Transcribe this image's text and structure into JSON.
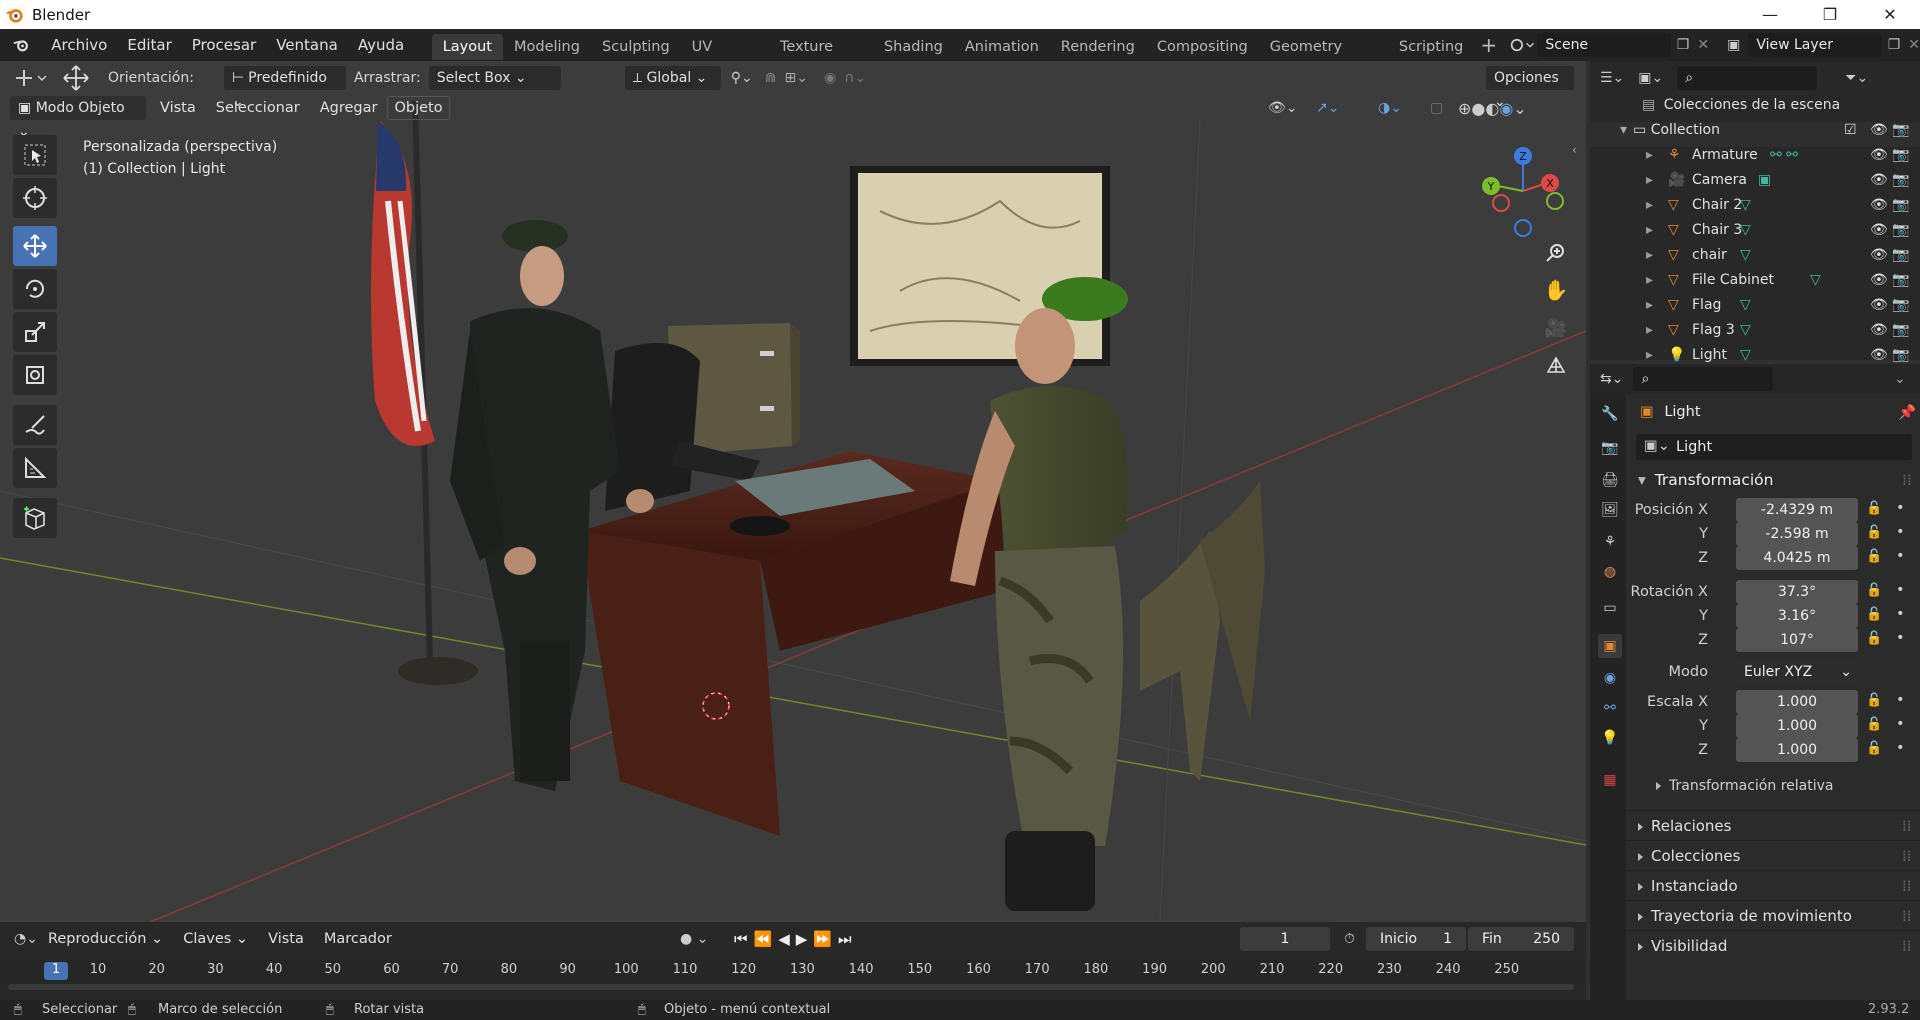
{
  "window": {
    "title": "Blender",
    "min": "—",
    "max": "❐",
    "close": "✕"
  },
  "menu": [
    "Archivo",
    "Editar",
    "Procesar",
    "Ventana",
    "Ayuda"
  ],
  "workspaces": [
    "Layout",
    "Modeling",
    "Sculpting",
    "UV Editing",
    "Texture Paint",
    "Shading",
    "Animation",
    "Rendering",
    "Compositing",
    "Geometry Nodes",
    "Scripting"
  ],
  "scene": "Scene",
  "view_layer": "View Layer",
  "toolbar": {
    "orientation_label": "Orientación:",
    "orientation_value": "Predefinido",
    "drag_label": "Arrastrar:",
    "drag_value": "Select Box",
    "transform_value": "Global",
    "options": "Opciones"
  },
  "viewport_header": {
    "mode": "Modo Objeto",
    "menus": [
      "Vista",
      "Seleccionar",
      "Agregar",
      "Objeto"
    ]
  },
  "overlay": {
    "view_name": "Personalizada (perspectiva)",
    "context": "(1) Collection | Light"
  },
  "gizmo": {
    "z": "Z",
    "x": "X",
    "y": "Y"
  },
  "outliner": {
    "root": "Colecciones de la escena",
    "collection": "Collection",
    "items": [
      {
        "name": "Armature",
        "color": "#e3872e"
      },
      {
        "name": "Camera",
        "color": "#e3872e"
      },
      {
        "name": "Chair 2",
        "color": "#e3872e"
      },
      {
        "name": "Chair 3",
        "color": "#e3872e"
      },
      {
        "name": "chair",
        "color": "#e3872e"
      },
      {
        "name": "File Cabinet",
        "color": "#e3872e"
      },
      {
        "name": "Flag",
        "color": "#e3872e"
      },
      {
        "name": "Flag 3",
        "color": "#e3872e"
      },
      {
        "name": "Light",
        "color": "#e3872e"
      }
    ]
  },
  "properties": {
    "object_name": "Light",
    "datablock": "Light",
    "transform_header": "Transformación",
    "pos_label": "Posición X",
    "pos": [
      "-2.4329 m",
      "-2.598 m",
      "4.0425 m"
    ],
    "rot_label": "Rotación X",
    "rot": [
      "37.3°",
      "3.16°",
      "107°"
    ],
    "mode_label": "Modo",
    "mode_value": "Euler XYZ",
    "scale_label": "Escala X",
    "scale": [
      "1.000",
      "1.000",
      "1.000"
    ],
    "axis_y": "Y",
    "axis_z": "Z",
    "relative": "Transformación relativa",
    "panels": [
      "Relaciones",
      "Colecciones",
      "Instanciado",
      "Trayectoria de movimiento",
      "Visibilidad"
    ]
  },
  "timeline": {
    "menus": [
      "Reproducción",
      "Claves",
      "Vista",
      "Marcador"
    ],
    "current_frame": "1",
    "start_label": "Inicio",
    "start": "1",
    "end_label": "Fin",
    "end": "250",
    "ruler": [
      "10",
      "20",
      "30",
      "40",
      "50",
      "60",
      "70",
      "80",
      "90",
      "100",
      "110",
      "120",
      "130",
      "140",
      "150",
      "160",
      "170",
      "180",
      "190",
      "200",
      "210",
      "220",
      "230",
      "240",
      "250"
    ],
    "current_marker": "1"
  },
  "status": {
    "select": "Seleccionar",
    "box": "Marco de selección",
    "rotate": "Rotar vista",
    "context": "Objeto - menú contextual",
    "version": "2.93.2"
  },
  "colors": {
    "accent": "#4772b3",
    "object_orange": "#e3872e",
    "mesh_teal": "#3fb8a0"
  }
}
